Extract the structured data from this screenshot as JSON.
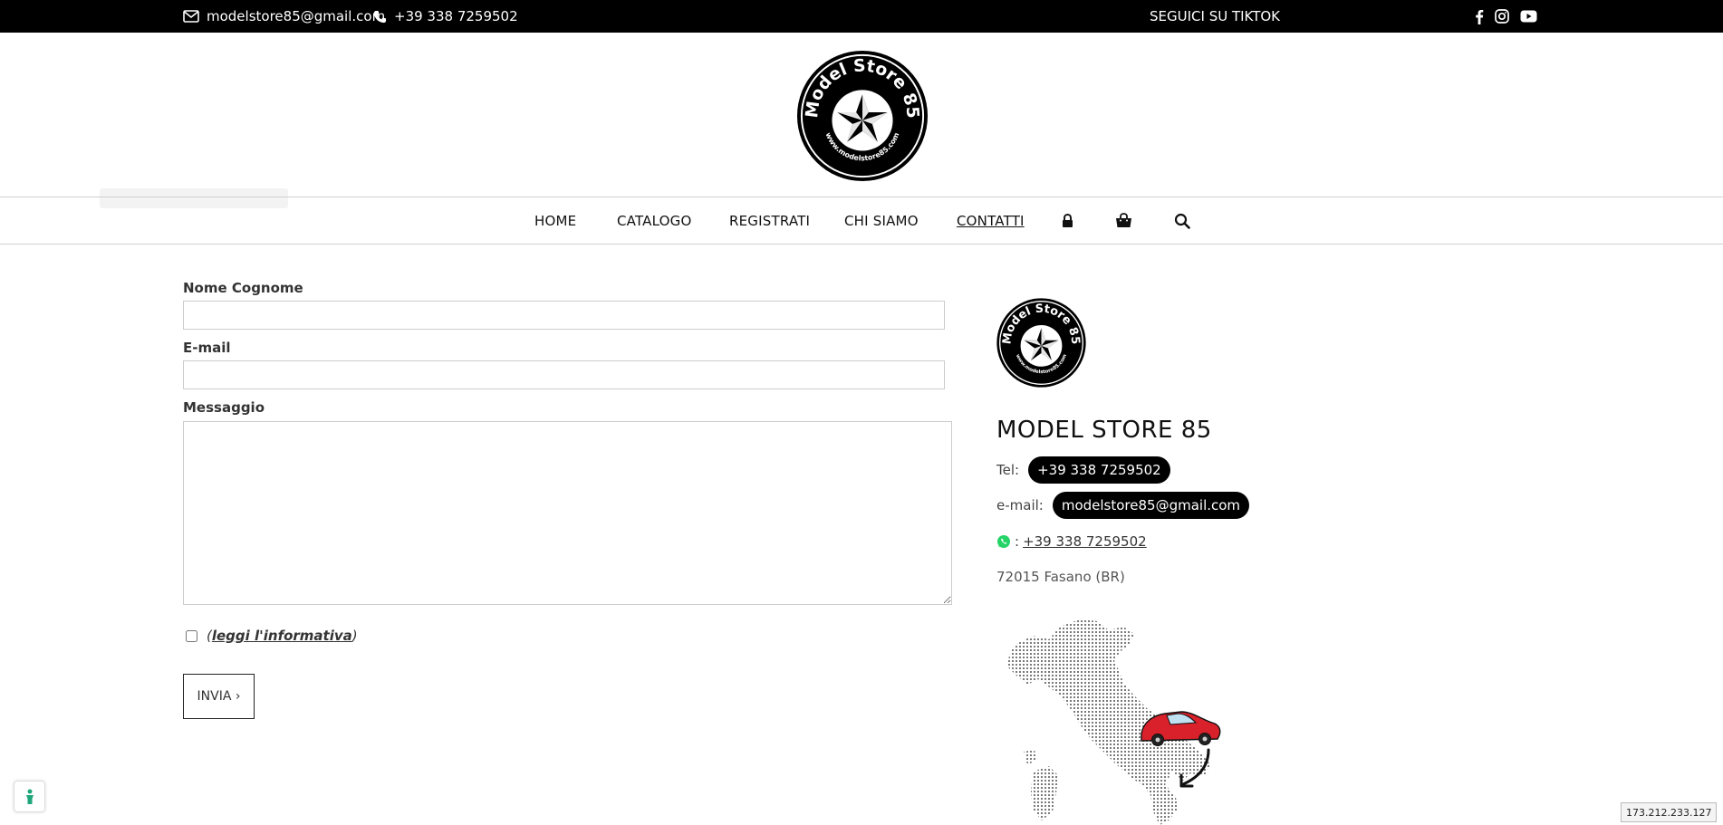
{
  "topbar": {
    "email": "modelstore85@gmail.com",
    "phone": "+39 338 7259502",
    "tiktok": "SEGUICI SU TIKTOK",
    "social_icons": [
      "facebook-icon",
      "instagram-icon",
      "youtube-icon"
    ]
  },
  "logo": {
    "text_top": "Model Store 85",
    "text_bottom": "www.modelstore85.com"
  },
  "nav": {
    "items": [
      {
        "label": "HOME"
      },
      {
        "label": "CATALOGO"
      },
      {
        "label": "REGISTRATI"
      },
      {
        "label": "CHI SIAMO"
      },
      {
        "label": "CONTATTI",
        "active": true
      }
    ],
    "icons": [
      "lock-icon",
      "shopping-bag-icon",
      "search-icon"
    ]
  },
  "form": {
    "name_label": "Nome Cognome",
    "name_value": "",
    "email_label": "E-mail",
    "email_value": "",
    "message_label": "Messaggio",
    "message_value": "",
    "privacy_open": "(",
    "privacy_link": "leggi l'informativa",
    "privacy_close": ")",
    "submit_label": "INVIA ›"
  },
  "store": {
    "name": "MODEL STORE 85",
    "tel_label": "Tel:",
    "tel": "+39 338 7259502",
    "email_label": "e-mail:",
    "email": "modelstore85@gmail.com",
    "whatsapp_sep": ":",
    "whatsapp": "+39 338 7259502",
    "address": "72015 Fasano (BR)"
  },
  "ip": "173.212.233.127",
  "colors": {
    "topbar_bg": "#000000",
    "pill_bg": "#000000",
    "whatsapp": "#25D366",
    "cookie_icon": "#1fa67a",
    "car_red": "#d8212b"
  }
}
